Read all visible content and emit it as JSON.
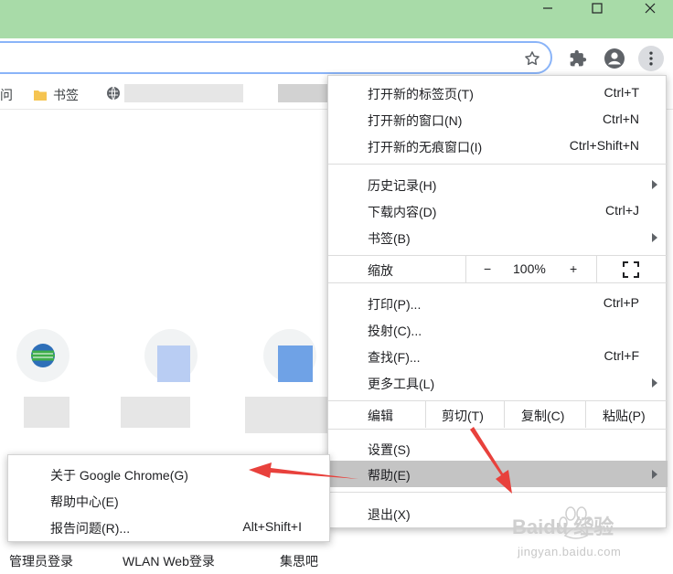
{
  "window": {
    "controls": [
      "minimize",
      "maximize",
      "close"
    ],
    "titlebar_color": "#a8dba8"
  },
  "toolbar": {
    "icons": [
      "star-icon",
      "extensions-icon",
      "profile-icon",
      "more-vert-icon"
    ]
  },
  "bookmarks_bar": {
    "items": [
      {
        "label": "问",
        "icon": "none"
      },
      {
        "label": "书签",
        "icon": "folder-icon"
      }
    ]
  },
  "bottom_links": [
    "管理员登录",
    "WLAN Web登录",
    "集思吧"
  ],
  "chrome_menu": {
    "items_top": [
      {
        "label": "打开新的标签页(T)",
        "shortcut": "Ctrl+T"
      },
      {
        "label": "打开新的窗口(N)",
        "shortcut": "Ctrl+N"
      },
      {
        "label": "打开新的无痕窗口(I)",
        "shortcut": "Ctrl+Shift+N"
      }
    ],
    "items_history": [
      {
        "label": "历史记录(H)",
        "shortcut": "",
        "submenu": true
      },
      {
        "label": "下载内容(D)",
        "shortcut": "Ctrl+J",
        "submenu": false
      },
      {
        "label": "书签(B)",
        "shortcut": "",
        "submenu": true
      }
    ],
    "zoom": {
      "label": "缩放",
      "minus": "−",
      "value": "100%",
      "plus": "+"
    },
    "items_tools": [
      {
        "label": "打印(P)...",
        "shortcut": "Ctrl+P",
        "submenu": false
      },
      {
        "label": "投射(C)...",
        "shortcut": "",
        "submenu": false
      },
      {
        "label": "查找(F)...",
        "shortcut": "Ctrl+F",
        "submenu": false
      },
      {
        "label": "更多工具(L)",
        "shortcut": "",
        "submenu": true
      }
    ],
    "edit": {
      "label": "编辑",
      "cut": "剪切(T)",
      "copy": "复制(C)",
      "paste": "粘贴(P)"
    },
    "settings": "设置(S)",
    "help": "帮助(E)",
    "exit": "退出(X)"
  },
  "help_submenu": {
    "items": [
      {
        "label": "关于 Google Chrome(G)",
        "shortcut": ""
      },
      {
        "label": "帮助中心(E)",
        "shortcut": ""
      },
      {
        "label": "报告问题(R)...",
        "shortcut": "Alt+Shift+I"
      }
    ]
  },
  "colors": {
    "highlight": "#c4c4c4",
    "arrow_red": "#e8413c",
    "omnibox_border": "#8ab4f8"
  },
  "watermark": {
    "brand": "Baidu 经验",
    "url": "jingyan.baidu.com"
  }
}
